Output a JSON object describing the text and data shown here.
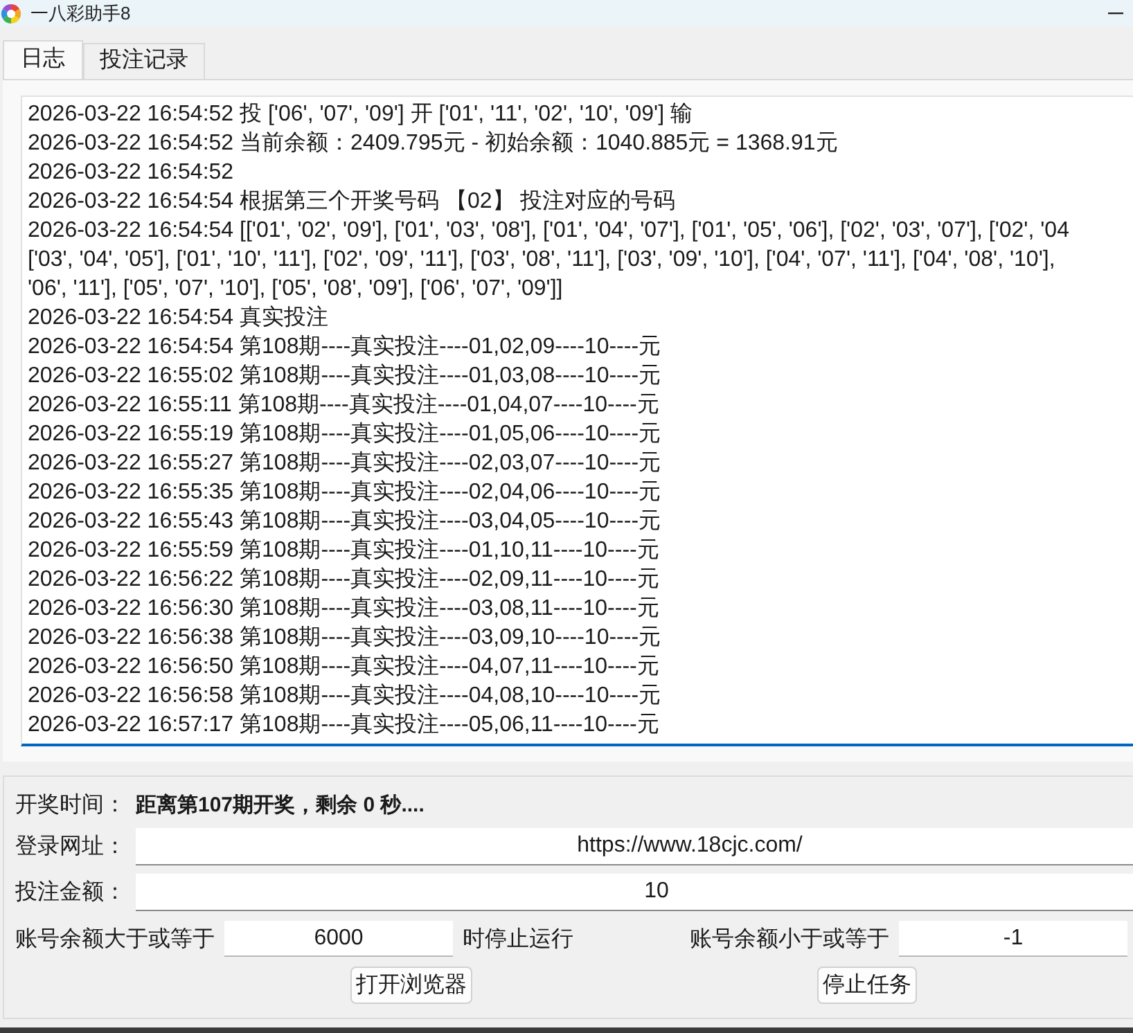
{
  "window": {
    "title": "一八彩助手8"
  },
  "tabs": [
    {
      "label": "日志",
      "selected": true
    },
    {
      "label": "投注记录",
      "selected": false
    }
  ],
  "log": {
    "lines": [
      "2026-03-22 16:54:52 投 ['06', '07', '09'] 开 ['01', '11', '02', '10', '09'] 输",
      "2026-03-22 16:54:52 当前余额：2409.795元 - 初始余额：1040.885元 = 1368.91元",
      "2026-03-22 16:54:52",
      "2026-03-22 16:54:54 根据第三个开奖号码 【02】 投注对应的号码",
      "2026-03-22 16:54:54 [['01', '02', '09'], ['01', '03', '08'], ['01', '04', '07'], ['01', '05', '06'], ['02', '03', '07'], ['02', '04",
      "['03', '04', '05'], ['01', '10', '11'], ['02', '09', '11'], ['03', '08', '11'], ['03', '09', '10'], ['04', '07', '11'], ['04', '08', '10'],",
      "'06', '11'], ['05', '07', '10'], ['05', '08', '09'], ['06', '07', '09']]",
      "2026-03-22 16:54:54 真实投注",
      "2026-03-22 16:54:54 第108期----真实投注----01,02,09----10----元",
      "2026-03-22 16:55:02 第108期----真实投注----01,03,08----10----元",
      "2026-03-22 16:55:11 第108期----真实投注----01,04,07----10----元",
      "2026-03-22 16:55:19 第108期----真实投注----01,05,06----10----元",
      "2026-03-22 16:55:27 第108期----真实投注----02,03,07----10----元",
      "2026-03-22 16:55:35 第108期----真实投注----02,04,06----10----元",
      "2026-03-22 16:55:43 第108期----真实投注----03,04,05----10----元",
      "2026-03-22 16:55:59 第108期----真实投注----01,10,11----10----元",
      "2026-03-22 16:56:22 第108期----真实投注----02,09,11----10----元",
      "2026-03-22 16:56:30 第108期----真实投注----03,08,11----10----元",
      "2026-03-22 16:56:38 第108期----真实投注----03,09,10----10----元",
      "2026-03-22 16:56:50 第108期----真实投注----04,07,11----10----元",
      "2026-03-22 16:56:58 第108期----真实投注----04,08,10----10----元",
      "2026-03-22 16:57:17 第108期----真实投注----05,06,11----10----元"
    ]
  },
  "draw_time": {
    "label": "开奖时间：",
    "value": "距离第107期开奖，剩余 0 秒...."
  },
  "login_url": {
    "label": "登录网址：",
    "value": "https://www.18cjc.com/"
  },
  "bet_amount": {
    "label": "投注金额：",
    "value": "10"
  },
  "balance_stop": {
    "upper_label": "账号余额大于或等于",
    "upper_value": "6000",
    "upper_suffix": "时停止运行",
    "lower_label": "账号余额小于或等于",
    "lower_value": "-1"
  },
  "buttons": [
    "打开浏览器",
    "停止任务"
  ]
}
